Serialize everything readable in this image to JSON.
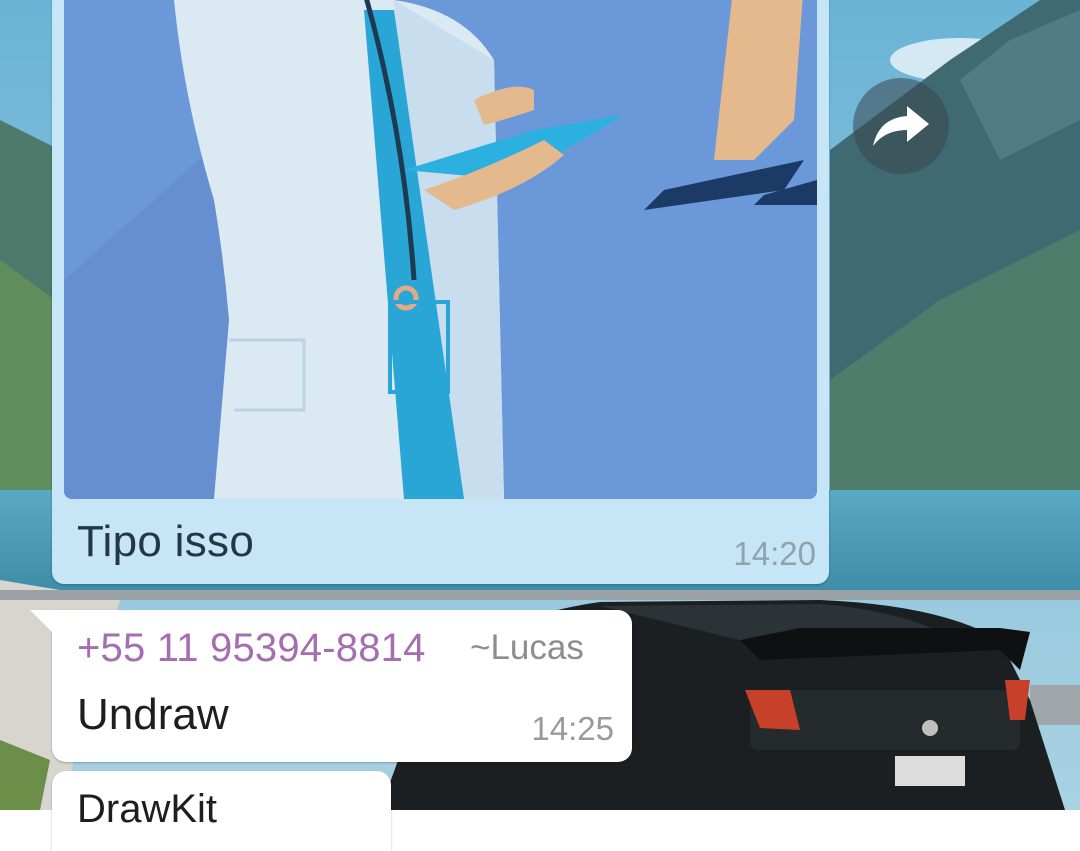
{
  "messages": [
    {
      "direction": "outgoing",
      "type": "image",
      "image_icon": "doctor-illustration-photo",
      "caption": "Tipo isso",
      "time": "14:20"
    },
    {
      "direction": "incoming",
      "sender_phone": "+55 11 95394-8814",
      "sender_alias": "~Lucas",
      "text": "Undraw",
      "time": "14:25"
    },
    {
      "direction": "incoming",
      "text_partial": "DrawKit"
    }
  ],
  "forward_button": {
    "icon": "forward-arrow-icon"
  },
  "colors": {
    "outgoing_bubble": "#c6e6f8",
    "incoming_bubble": "#ffffff",
    "sender_name": "#a46eb0",
    "time_text": "#8ea3ae"
  }
}
